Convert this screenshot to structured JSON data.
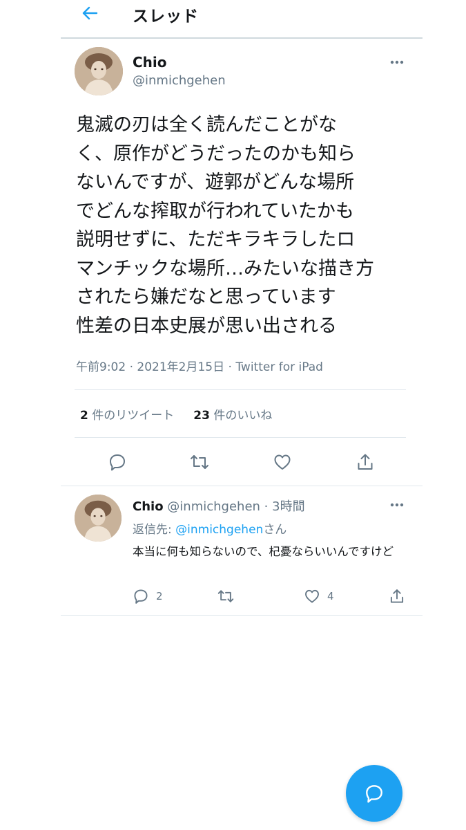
{
  "header": {
    "title": "スレッド",
    "back_icon": "arrow-left-icon"
  },
  "main_tweet": {
    "author_name": "Chio",
    "author_handle": "@inmichgehen",
    "lines": [
      "鬼滅の刃は全く読んだことがな",
      "く、原作がどうだったのかも知ら",
      "ないんですが、遊郭がどんな場所",
      "でどんな搾取が行われていたかも",
      "説明せずに、ただキラキラしたロ",
      "マンチックな場所…みたいな描き方",
      "されたら嫌だなと思っています",
      "性差の日本史展が思い出される"
    ],
    "time": "午前9:02",
    "date": "2021年2月15日",
    "source": "Twitter for iPad",
    "retweet_count": "2",
    "retweet_label": "件のリツイート",
    "like_count": "23",
    "like_label": "件のいいね",
    "actions": [
      "reply-icon",
      "retweet-icon",
      "like-icon",
      "share-icon"
    ]
  },
  "reply_tweet": {
    "author_name": "Chio",
    "author_handle": "@inmichgehen",
    "separator": "·",
    "time_ago": "3時間",
    "replying_prefix": "返信先:",
    "replying_mention": "@inmichgehen",
    "replying_suffix": "さん",
    "text": "本当に何も知らないので、杞憂ならいいんですけど",
    "reply_count": "2",
    "like_count": "4"
  },
  "colors": {
    "accent": "#1da1f2",
    "text": "#14171a",
    "secondary": "#657786",
    "border": "#e1e8ed"
  },
  "fab": {
    "icon": "compose-reply-icon"
  }
}
